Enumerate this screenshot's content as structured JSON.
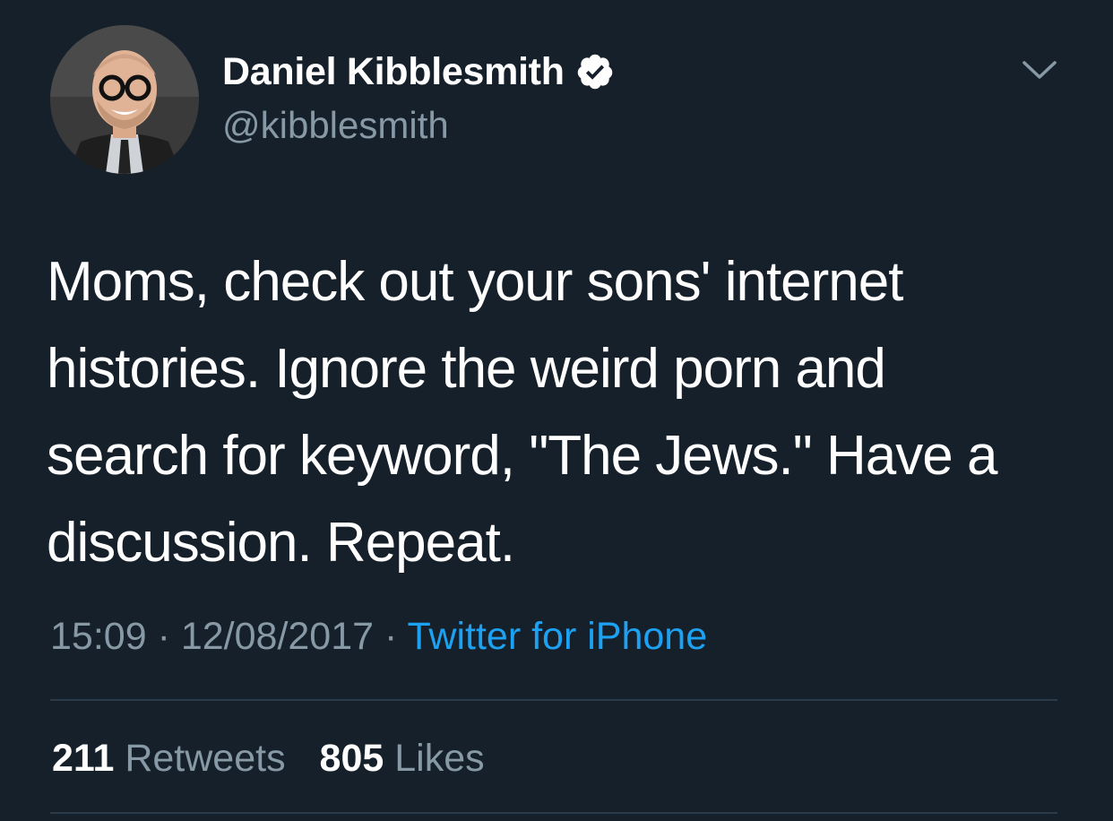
{
  "author": {
    "display_name": "Daniel Kibblesmith",
    "handle": "@kibblesmith",
    "verified": true,
    "avatar_icon": "profile-photo"
  },
  "tweet": {
    "text_lines": [
      "Moms, check out your sons' internet",
      "histories. Ignore the weird porn and",
      "search for keyword, \"The Jews.\" Have a",
      "discussion. Repeat."
    ]
  },
  "meta": {
    "time": "15:09",
    "separator": "·",
    "date": "12/08/2017",
    "source": "Twitter for iPhone"
  },
  "stats": {
    "retweets_count": "211",
    "retweets_label": "Retweets",
    "likes_count": "805",
    "likes_label": "Likes"
  },
  "icons": {
    "verified": "verified-badge-icon",
    "caret": "chevron-down-icon"
  },
  "colors": {
    "background": "#15202b",
    "primary_text": "#ffffff",
    "secondary_text": "#8899a6",
    "link": "#1da1f2",
    "divider": "#2b3a48"
  }
}
